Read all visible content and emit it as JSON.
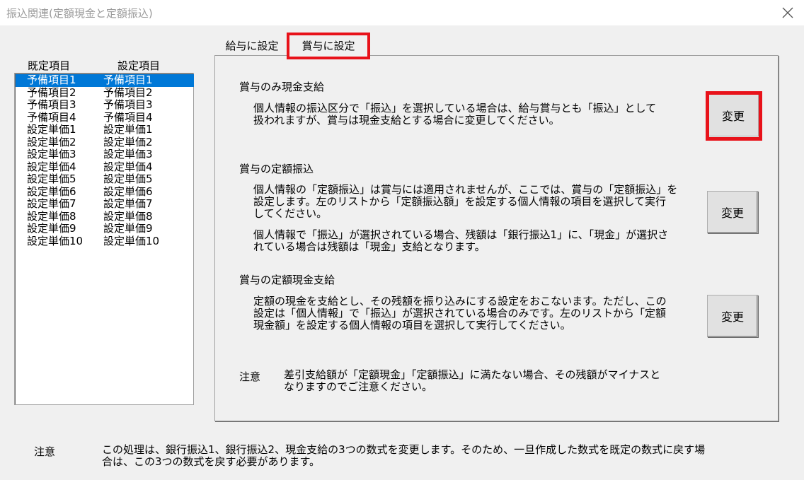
{
  "window": {
    "title": "振込関連(定額現金と定額振込)",
    "close_icon": "close-x-icon"
  },
  "list": {
    "header_default": "既定項目",
    "header_setting": "設定項目",
    "rows": [
      {
        "default": "予備項目1",
        "setting": "予備項目1",
        "selected": true
      },
      {
        "default": "予備項目2",
        "setting": "予備項目2"
      },
      {
        "default": "予備項目3",
        "setting": "予備項目3"
      },
      {
        "default": "予備項目4",
        "setting": "予備項目4"
      },
      {
        "default": "設定単価1",
        "setting": "設定単価1"
      },
      {
        "default": "設定単価2",
        "setting": "設定単価2"
      },
      {
        "default": "設定単価3",
        "setting": "設定単価3"
      },
      {
        "default": "設定単価4",
        "setting": "設定単価4"
      },
      {
        "default": "設定単価5",
        "setting": "設定単価5"
      },
      {
        "default": "設定単価6",
        "setting": "設定単価6"
      },
      {
        "default": "設定単価7",
        "setting": "設定単価7"
      },
      {
        "default": "設定単価8",
        "setting": "設定単価8"
      },
      {
        "default": "設定単価9",
        "setting": "設定単価9"
      },
      {
        "default": "設定単価10",
        "setting": "設定単価10"
      }
    ]
  },
  "tabs": {
    "salary": "給与に設定",
    "bonus": "賞与に設定",
    "active": "bonus"
  },
  "sections": {
    "cash_only": {
      "title": "賞与のみ現金支給",
      "desc": "個人情報の振込区分で「振込」を選択している場合は、給与賞与とも「振込」として\n扱われますが、賞与は現金支給とする場合に変更してください。",
      "button": "変更"
    },
    "fixed_transfer": {
      "title": "賞与の定額振込",
      "desc1": "個人情報の「定額振込」は賞与には適用されませんが、ここでは、賞与の「定額振込」を\n設定します。左のリストから「定額振込額」を設定する個人情報の項目を選択して実行\nしてください。",
      "desc2": "個人情報で「振込」が選択されている場合、残額は「銀行振込1」に、「現金」が選択さ\nれている場合は残額は「現金」支給となります。",
      "button": "変更"
    },
    "fixed_cash": {
      "title": "賞与の定額現金支給",
      "desc": "定額の現金を支給とし、その残額を振り込みにする設定をおこないます。ただし、この\n設定は「個人情報」で「振込」が選択されている場合のみです。左のリストから「定額\n現金額」を設定する個人情報の項目を選択して実行してください。",
      "button": "変更"
    },
    "note": {
      "label": "注意",
      "text": "差引支給額が「定額現金」「定額振込」に満たない場合、その残額がマイナスと\nなりますのでご注意ください。"
    }
  },
  "footer": {
    "label": "注意",
    "text": "この処理は、銀行振込1、銀行振込2、現金支給の3つの数式を変更します。そのため、一旦作成した数式を既定の数式に戻す場\n合は、この3つの数式を戻す必要があります。"
  },
  "colors": {
    "highlight": "#e8121a",
    "selection": "#0078d7"
  }
}
